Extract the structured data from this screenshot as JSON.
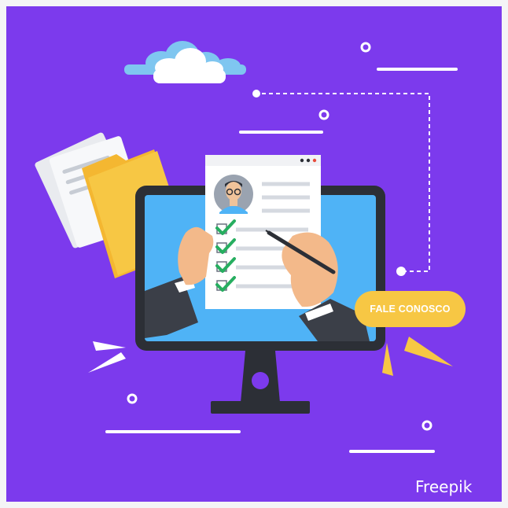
{
  "cta": {
    "label": "FALE CONOSCO"
  },
  "credit": {
    "text": "Freepik"
  },
  "colors": {
    "background": "#7c3aed",
    "accent": "#f7c744",
    "screen": "#4fb3f6",
    "monitor": "#2c2f36",
    "check": "#27ae60"
  },
  "icons": [
    "cloud",
    "folder",
    "documents",
    "monitor",
    "resume",
    "avatar",
    "checkmark",
    "pen",
    "hands"
  ]
}
